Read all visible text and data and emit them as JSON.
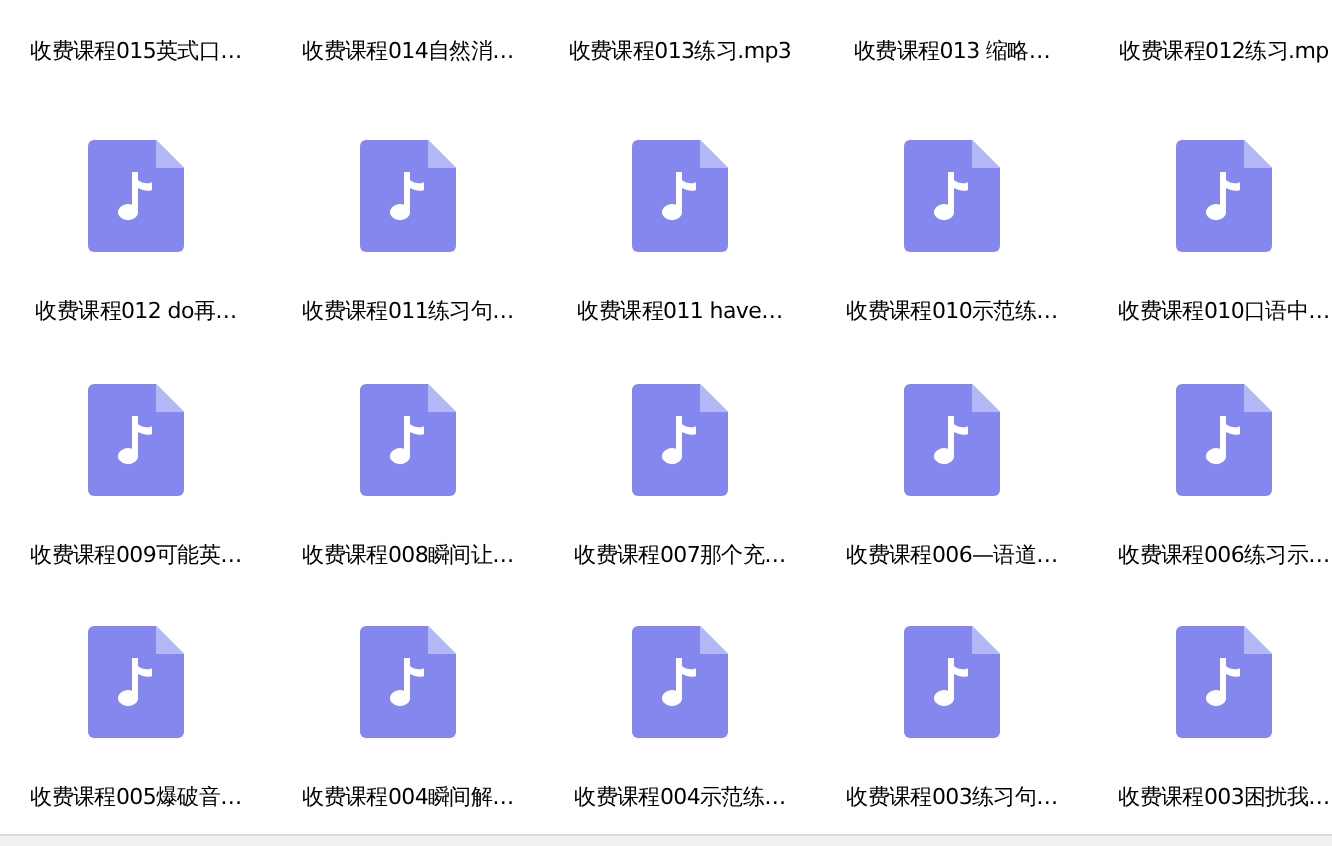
{
  "rows": [
    {
      "kind": "label",
      "items": [
        "收费课程015英式口…",
        "收费课程014自然消…",
        "收费课程013练习.mp3",
        "收费课程013 缩略…",
        "收费课程012练习.mp"
      ]
    },
    {
      "kind": "file",
      "items": [
        "收费课程012 do再…",
        "收费课程011练习句…",
        "收费课程011 have…",
        "收费课程010示范练…",
        "收费课程010口语中…"
      ]
    },
    {
      "kind": "file",
      "items": [
        "收费课程009可能英…",
        "收费课程008瞬间让…",
        "收费课程007那个充…",
        "收费课程006—语道…",
        "收费课程006练习示…"
      ]
    },
    {
      "kind": "file",
      "items": [
        "收费课程005爆破音…",
        "收费课程004瞬间解…",
        "收费课程004示范练…",
        "收费课程003练习句…",
        "收费课程003困扰我…"
      ]
    }
  ]
}
